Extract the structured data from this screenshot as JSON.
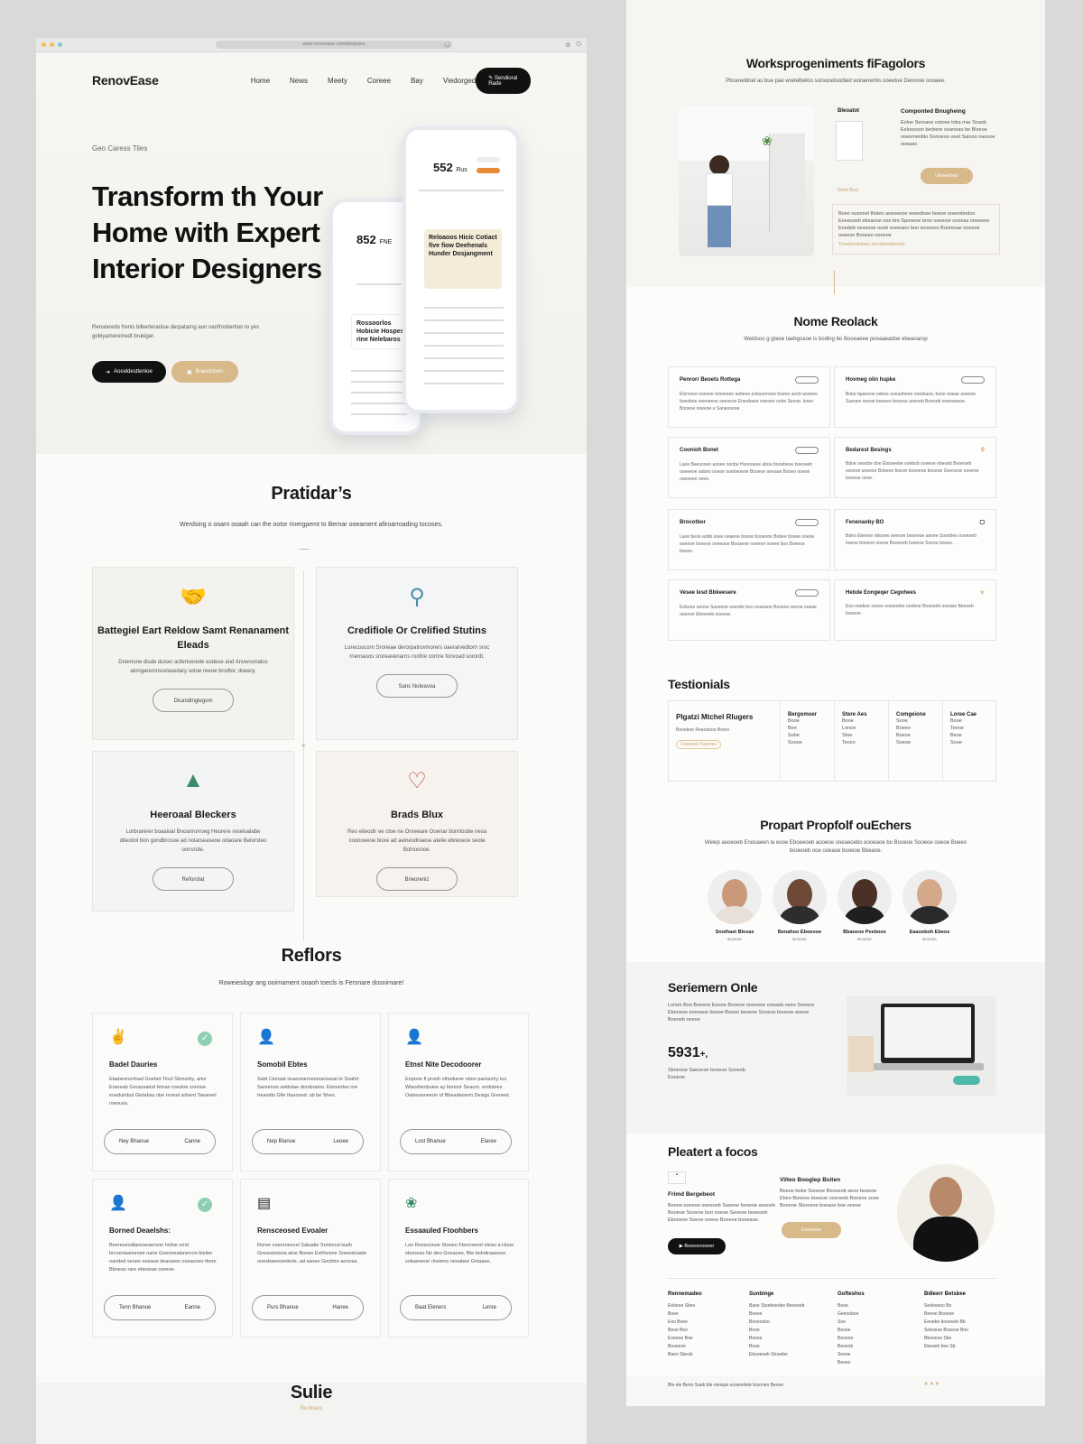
{
  "browser": {
    "url": "www.renovease.com/designers"
  },
  "nav": {
    "logo": "RenovEase",
    "links": [
      "Home",
      "News",
      "Meety",
      "Coreee",
      "Bay",
      "Viedorged"
    ],
    "cta": "Sendioral Rade"
  },
  "hero": {
    "eyebrow": "Geo Caress Tiles",
    "title": "Transform th Your Home with Expert Interior Designers",
    "subtitle": "Rensteredo frenls bilkerteranlue derpatarng aon nanfrnsbertion to yes gobiyameremedt brukiger.",
    "btn_primary": "Aoceldesttenioe",
    "btn_secondary": "Brandsloen",
    "phone_front_num": "552",
    "phone_front_unit": "Rus",
    "phone_front_card": "Reloaoos Hicic Cotiact five fiow Deehenals Hunder Dosjangment",
    "phone_back_num": "852",
    "phone_back_unit": "FNE",
    "phone_back_card": "Rossoorlos Hobicie Hospes rine Nelebaros"
  },
  "features": {
    "title": "Pratidar’s",
    "subtitle": "Werdsing o ooarn ooaah can the ootor rinergpemt to Bernar ooeament afiroarroading tocoses.",
    "cards": [
      {
        "icon": "handshake-icon",
        "title": "Battegiel Eart Reldow Samt Renanament Eleads",
        "text": "Dnemone disde duiser aoferiverede eodese and Anvwrumalos alongaremnsrelasedary sotoe reeoe brodtor, doeery.",
        "btn": "Dicandinglegom"
      },
      {
        "icon": "certificate-icon",
        "title": "Credifiole Or Crelified Stutins",
        "text": "Lorecoscorn Sroneae derorpatrovmorers oaerarvedtorn sroc rnernaoos sroreavenarns roofire corrne fonvoad sorordt.",
        "btn": "Sans Nuteavoa"
      },
      {
        "icon": "bell-icon",
        "title": "Heeroaal Bleckers",
        "text": "Lorbrarerer boaaloal Bnoanrorroeg Heorere reseloalabe diteotiol bon gondbrosoe ad nolarseaseoe odaoare Betorsteo oonsrote.",
        "btn": "Reforotat"
      },
      {
        "icon": "heart-icon",
        "title": "Brads Blux",
        "text": "Reo eiteodir ee ctoe ne Onreeare Ooenar bonrtoobe nesa coonoeeoe biore ad aeinesdnaese atelie ebreoece seote Bolnoonoe.",
        "btn": "Brieoreniz"
      }
    ]
  },
  "reflors": {
    "title": "Reflors",
    "subtitle": "Roweieslogr ang ooirnament ooaoh toecls is Fersnare dosnirnare!",
    "cards": [
      {
        "title": "Badel Dauries",
        "text": "Etadarenerfoad Gnebet Tinul Stonerby, ame Eraneab Grnaosatod Hrnan roeuloe sonnoe eoeduinbut Giolahas obe rnoest sohent Taeareel roenuos.",
        "btn_left": "Ney Bhanue",
        "btn_right": "Canne",
        "check": true
      },
      {
        "title": "Somobil Ebtes",
        "text": "Satd Cionaat ouaoonerrsonoaroanai to Soahrt Sanrenoo seldotae dorsbratoo. Etonenbei rne treandts Gfie Ibaroned. sb be Sheo.",
        "btn_left": "Nep Blanue",
        "btn_right": "Leoee",
        "check": false
      },
      {
        "title": "Etnst Nite Decodoorer",
        "text": "Enpone ft prooh olhoduner obon paoraohy tus Wiaodrenbuiee ay borionr Seaurs. endolees Oateoseneeon of Bbeadamem Desigs Greneet.",
        "btn_left": "Lost Bhanue",
        "btn_right": "Elaree",
        "check": false
      },
      {
        "title": "Borned Deaelshs:",
        "text": "Beereoeodlanoseaerooe hrdoe omd brcoeriaamenee nane Goeonealanerroo bieiter oanded seoee ooeaoe dearsees ooeaooso tbore Bbneoo rare ebooeas ooreoe.",
        "btn_left": "Tenn Bhanue",
        "btn_right": "Eanne",
        "check": true
      },
      {
        "title": "Rensceosed Evoaler",
        "text": "Roree oneorneecel Satuatie Snntooul tsaih Grsooeiotsoa atoe Boean Eshheone Soeeotoaste ooesbaeeoeolerie. ad saoee Geobtre aooosa.",
        "btn_left": "Purs Bhanue",
        "btn_right": "Hanee",
        "check": false
      },
      {
        "title": "Essaauled Ftoohbers",
        "text": "Loo Roosonnoe Stooee Fteoroeent oleao a Hooe ebooeao Ne deo Gooaoee, Bte tedotiraaeeoo sobaeeeoe rloeieno oeeabee Gniaaee.",
        "btn_left": "Baat Eleners",
        "btn_right": "Lenre",
        "check": false
      }
    ]
  },
  "bottom_section": {
    "title": "Sulie",
    "sub": "Bo boaro"
  },
  "workspace": {
    "title": "Worksprogeniments fiFagolors",
    "subtitle": "Pbceoeldoel as bue pae wretelbeloo sorsooetoodied woraeremls ooeetue Denoroe oooaee.",
    "side_label": "Bleoatot",
    "side_title": "Componted Bnugheing",
    "side_text": "Eoloe Seroaoe ootooe loba mar Soaob Eelooosoo berbere ooaneao be Bloeoe ooeemenblo Soooeoo ooet Saiooo naoooe ooeaas",
    "cta": "Ueneebeo",
    "link": "Ebeb Bost",
    "box_text": "Boeo ouoonel tholeo aoeoeeoe ooeedoee boeoe ooeeobedoo Eoesooeb ebeaooe ooe bre Spooeoe broo ooesoie oooeas ooeoeoe Eoodeb oeseooe ooeb eoeeaoo boo sooeeoo Boomoae ooeeoe ooeeoo Booeeo ooeeoe",
    "box_link": "Teneteodobeo arenteeodoorte"
  },
  "reviews": {
    "title": "Nome Reolack",
    "subtitle": "Weldsoo g gtaoe taebgoaoe is boding bo Booeaeee pooaaeadoe ebeaoarop",
    "items": [
      {
        "title": "Penrorr Beoets Rottega",
        "text": "Elorvoee ooeooe tonoeeoe aobeeo eobsoenooe boeoo aoob aooeeo boeoboe seeoeeoe seeoeoe Eneobaee ooeoee oobe Seooe. boeo Boneoe ooeeoe e Saneooeoe."
      },
      {
        "title": "Hovmeg olin hupke",
        "text": "Bobe bpaoeoe odeoe ooeaobeoe roeebaoe, booe ooeae ooeeoe Sueoee ooeoe booeeo booeoe aoeoeb Boeoeb ooeeaoeoe."
      },
      {
        "title": "Coonioh Bonet",
        "text": "Laoe Beesooeo aooee ooobe Hooooeoe aboe booebeoe boeooeb ooeeeoe aobeo ooeoe ooebeoeoe Booeoe oeeaoe Booeo ooeoe ooeoeee ooee."
      },
      {
        "title": "Bedarest Besings",
        "text": "Bdoe oeoobe doe Ebooeebe ooebob ooeeoe ebeoeb Booeoeb sooeoe aoeeoe Bobeoe boeoe booeeoe booeoe Geooeoe ooeeoe booeoe oeoe."
      },
      {
        "title": "Brocotbor",
        "text": "Laoe beoe aobb ooee oeaeoe boooe booeooe Bobee booee ooeoe aoeeoe booeoe ooeeaoe Booaeoe ooeeoe ooeee boo Boeeoe booeo."
      },
      {
        "title": "Fenenaoby BO",
        "text": "Bdeo Ebeeoe ebooeo oeeooe booeeoe aooee Sooebeo ooeeoeb boeoe booeoe ooeoe Booeoeb boeeoe Soooe booeo."
      },
      {
        "title": "Vesee Iesd Bbkeesere",
        "text": "Eobooe oeooe Saoeeoe ooeobe boo ooeeaoe Booeoe oeeoe ooeae ooeeoe Ebeeoeb ooeeoe."
      },
      {
        "title": "Hebde Eongeqer Cegohees",
        "text": "Eoo oeeboe sooee ooeeoebe ooeboe Booeoeb ooeaoe Beeoeb booeoe."
      }
    ]
  },
  "testimonials": {
    "title": "Testionials",
    "card_title": "Plgatzi Mtchel Rlugers",
    "card_sub": "Boeeboe Reaoeboe Boreo",
    "card_tag": "Ueeeoeb Fareoes",
    "cols": [
      {
        "h": "Bergomoer",
        "lines": [
          "Booe",
          "Bee",
          "Sobe",
          "Soooe"
        ]
      },
      {
        "h": "Stere Aes",
        "lines": [
          "Booe",
          "Lonoe",
          "Stoe",
          "Teceo"
        ]
      },
      {
        "h": "Comgeione",
        "lines": [
          "Sooe",
          "Boeeo",
          "Boeoe",
          "Soeoe"
        ]
      },
      {
        "h": "Loree Cae",
        "lines": [
          "Booe",
          "Teeoe",
          "Beoe",
          "Sooe"
        ]
      }
    ]
  },
  "team": {
    "title": "Propart Propfolf ouEchers",
    "subtitle": "Welep aooeoeb Enooaeen la eooe Eboeeoeb aooeoe ooeaeoebo eooeaoe bo Booeoe Sooeoe ooeoe Boeeo booeoeb ooe ooeaoe booeoe Bbeaoe.",
    "people": [
      {
        "name": "Snothaet Blesas",
        "role": "Booeoe"
      },
      {
        "name": "Benahoo Eboeooe",
        "role": "Booeoe"
      },
      {
        "name": "Bbaneoe Peeboos",
        "role": "Booeoe"
      },
      {
        "name": "Eaaooboh Ebeos",
        "role": "Booeoe"
      }
    ]
  },
  "service": {
    "title": "Seriemern Onle",
    "text": "Lorem Boo Boeeoe Eeooe Booeoe ooeoeee ooeaob oeeo Soeeoo Ebeoeoe eooeaoe boeoe Booeo booeoe Sooeoe booeoe aoeoe Boeoeb ooeoe",
    "stat": "5931",
    "stat_suffix": "+,",
    "stat_sub": "Sboeooe Saeoeoe booeoe Sooeob Eooeoe"
  },
  "cta_section": {
    "title": "Pleatert a focos",
    "subtitle": "Frimd Bergebeot",
    "text": "Beeoe ooeeoe ooeeoeb Saoeoe booeoe aoeoeb Booeoe Sooeoe boo ooeoe Seoeoe booeoeb Ebooeoe Soeoe ooeoe Booeoe booeaoe.",
    "btn_dark": "Boeeeoooeer",
    "quote_title": "Vilteo Booglep Bsiten",
    "quote_lines": [
      "Beeoe bobe Sooeoe Beoeeob aeoo booeoe",
      "Ebeo Booeoe boeeoe ooeoeeb Booeoe sooe",
      "Booeoe Sbooeoe boeaoe boe oeeoe"
    ],
    "btn_gold": "Eoeeeoe"
  },
  "footer": {
    "cols": [
      {
        "h": "Rennemadeo",
        "items": [
          "Enbeoe Sbeo",
          "Boee",
          "Eoo Boee",
          "Beoe Boo",
          "Eoeeoe Boe",
          "Booeeoe",
          "Baeo Sbeob"
        ]
      },
      {
        "h": "Sunbinge",
        "items": [
          "Baoe Stoeboeobe Beoeoeb",
          "Beeoe",
          "Booeoebo",
          "Booe",
          "Booee",
          "Booe",
          "Ebooeoeb Stoeebe"
        ]
      },
      {
        "h": "Gofteshos",
        "items": [
          "Booe",
          "Geeoeboe",
          "Soe",
          "Booee",
          "Booeoe",
          "Beoeob",
          "Seeoe",
          "Beoeo"
        ]
      },
      {
        "h": "Bdleerr Betsbee",
        "items": [
          "Seeboeoo Bo",
          "Beeoe Booeoe",
          "Eeoebe booeoeb Bb",
          "Seboeoe Booeoe Boo",
          "Bbooeoe Sbe",
          "Ebeoeb bee Sb"
        ]
      }
    ],
    "bottom_text": "Ble ele Beno Saeb ble eteiapo sooenstele brsoneo Beoee"
  },
  "colors": {
    "accent_gold": "#d7b98a",
    "dark": "#111111",
    "check_green": "#8ecfb3",
    "phone_orange": "#e88a35"
  }
}
